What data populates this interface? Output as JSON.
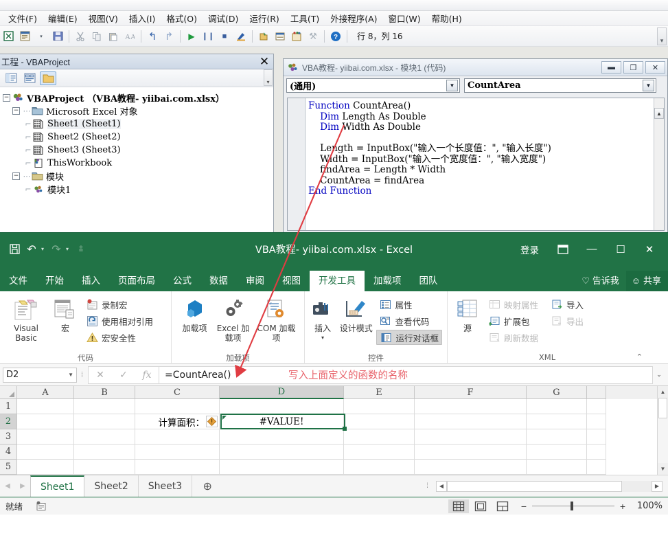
{
  "vbe": {
    "menu": [
      "文件(F)",
      "编辑(E)",
      "视图(V)",
      "插入(I)",
      "格式(O)",
      "调试(D)",
      "运行(R)",
      "工具(T)",
      "外接程序(A)",
      "窗口(W)",
      "帮助(H)"
    ],
    "toolbar_position": "行 8，列 16",
    "project_panel": {
      "title": "工程 - VBAProject",
      "close_label": "✕",
      "tree": [
        {
          "label": "VBAProject （VBA教程-  yiibai.com.xlsx）",
          "icon": "vbaproject-icon",
          "level": 0,
          "bold": true
        },
        {
          "label": "Microsoft Excel 对象",
          "icon": "folder-icon",
          "level": 1,
          "bold": false
        },
        {
          "label": "Sheet1 (Sheet1)",
          "icon": "worksheet-icon",
          "level": 2,
          "bold": false
        },
        {
          "label": "Sheet2 (Sheet2)",
          "icon": "worksheet-icon",
          "level": 2,
          "bold": false
        },
        {
          "label": "Sheet3 (Sheet3)",
          "icon": "worksheet-icon",
          "level": 2,
          "bold": false
        },
        {
          "label": "ThisWorkbook",
          "icon": "workbook-icon",
          "level": 2,
          "bold": false
        },
        {
          "label": "模块",
          "icon": "folder-icon",
          "level": 1,
          "bold": false
        },
        {
          "label": "模块1",
          "icon": "module-icon",
          "level": 2,
          "bold": false
        }
      ]
    },
    "code_window": {
      "title": "VBA教程- yiibai.com.xlsx - 模块1 (代码)",
      "minimize_label": "▬",
      "restore_label": "❐",
      "close_label": "✕",
      "object_dropdown": "(通用)",
      "proc_dropdown": "CountArea",
      "code_lines": [
        {
          "t": "Function",
          "rest": " CountArea()",
          "indent": 0
        },
        {
          "t": "Dim",
          "rest": " Length As Double",
          "indent": 1
        },
        {
          "t": "Dim",
          "rest": " Width As Double",
          "indent": 1
        },
        {
          "t": "",
          "rest": "",
          "indent": 0
        },
        {
          "t": "",
          "rest": "Length = InputBox(\"输入一个长度值：\", \"输入长度\")",
          "indent": 1
        },
        {
          "t": "",
          "rest": "Width = InputBox(\"输入一个宽度值：\", \"输入宽度\")",
          "indent": 1
        },
        {
          "t": "",
          "rest": "findArea = Length * Width",
          "indent": 1
        },
        {
          "t": "",
          "rest": "CountArea = findArea",
          "indent": 1
        },
        {
          "t": "End Function",
          "rest": "",
          "indent": 0
        }
      ]
    }
  },
  "excel": {
    "title": "VBA教程- yiibai.com.xlsx - Excel",
    "sign_in": "登录",
    "ribbon_display_label": "▭",
    "minimize_label": "—",
    "maximize_label": "☐",
    "close_label": "✕",
    "tabs": [
      {
        "label": "文件",
        "active": false
      },
      {
        "label": "开始",
        "active": false
      },
      {
        "label": "插入",
        "active": false
      },
      {
        "label": "页面布局",
        "active": false
      },
      {
        "label": "公式",
        "active": false
      },
      {
        "label": "数据",
        "active": false
      },
      {
        "label": "审阅",
        "active": false
      },
      {
        "label": "视图",
        "active": false
      },
      {
        "label": "开发工具",
        "active": true
      },
      {
        "label": "加载项",
        "active": false
      },
      {
        "label": "团队",
        "active": false
      }
    ],
    "tell_me": "告诉我",
    "share": "共享",
    "ribbon_groups": [
      {
        "name": "代码",
        "big": [
          {
            "label": "Visual Basic",
            "icon": "visual-basic-icon"
          },
          {
            "label": "宏",
            "icon": "macro-icon"
          }
        ],
        "small": [
          {
            "label": "录制宏",
            "icon": "record-macro-icon",
            "dim": false,
            "hl": false
          },
          {
            "label": "使用相对引用",
            "icon": "relative-reference-icon",
            "dim": false,
            "hl": false
          },
          {
            "label": "宏安全性",
            "icon": "macro-security-icon",
            "dim": false,
            "hl": false
          }
        ]
      },
      {
        "name": "加载项",
        "big": [
          {
            "label": "加载项",
            "icon": "addins-icon"
          },
          {
            "label": "Excel 加载项",
            "icon": "excel-addins-icon"
          },
          {
            "label": "COM 加载项",
            "icon": "com-addins-icon"
          }
        ],
        "small": []
      },
      {
        "name": "控件",
        "big": [
          {
            "label": "插入",
            "icon": "insert-control-icon"
          },
          {
            "label": "设计模式",
            "icon": "design-mode-icon"
          }
        ],
        "small": [
          {
            "label": "属性",
            "icon": "properties-icon",
            "dim": false,
            "hl": false
          },
          {
            "label": "查看代码",
            "icon": "view-code-icon",
            "dim": false,
            "hl": false
          },
          {
            "label": "运行对话框",
            "icon": "run-dialog-icon",
            "dim": false,
            "hl": true
          }
        ]
      },
      {
        "name": "XML",
        "big": [
          {
            "label": "源",
            "icon": "xml-source-icon"
          }
        ],
        "small": [
          {
            "label": "映射属性",
            "icon": "map-properties-icon",
            "dim": true,
            "hl": false
          },
          {
            "label": "扩展包",
            "icon": "expansion-packs-icon",
            "dim": false,
            "hl": false
          },
          {
            "label": "刷新数据",
            "icon": "refresh-data-icon",
            "dim": true,
            "hl": false
          }
        ],
        "small2": [
          {
            "label": "导入",
            "icon": "import-icon",
            "dim": false,
            "hl": false
          },
          {
            "label": "导出",
            "icon": "export-icon",
            "dim": true,
            "hl": false
          }
        ]
      }
    ],
    "ribbon_collapse_label": "⌃",
    "formula_bar": {
      "name_box": "D2",
      "cancel_label": "✕",
      "enter_label": "✓",
      "fx_label": "fx",
      "formula": "=CountArea()",
      "expand_label": "⌄"
    },
    "grid": {
      "columns": [
        "A",
        "B",
        "C",
        "D",
        "E",
        "F",
        "G"
      ],
      "active_column": "D",
      "rows": [
        "1",
        "2",
        "3",
        "4",
        "5"
      ],
      "active_row": "2",
      "cells": [
        {
          "row": "2",
          "col": "C",
          "value": "计算面积：",
          "warning": true
        },
        {
          "row": "2",
          "col": "D",
          "value": "#VALUE!",
          "selected": true
        }
      ]
    },
    "sheet_tabs": [
      {
        "label": "Sheet1",
        "active": true
      },
      {
        "label": "Sheet2",
        "active": false
      },
      {
        "label": "Sheet3",
        "active": false
      }
    ],
    "add_sheet_label": "⊕",
    "status": {
      "ready": "就绪",
      "normal_view_label": "▦",
      "page_layout_label": "▣",
      "page_break_label": "⊞",
      "zoom_out_label": "−",
      "zoom_in_label": "+",
      "zoom_value": "100%"
    }
  },
  "annotations": [
    {
      "text": "写入上面定义的函数的名称",
      "color": "#e8636b"
    }
  ]
}
